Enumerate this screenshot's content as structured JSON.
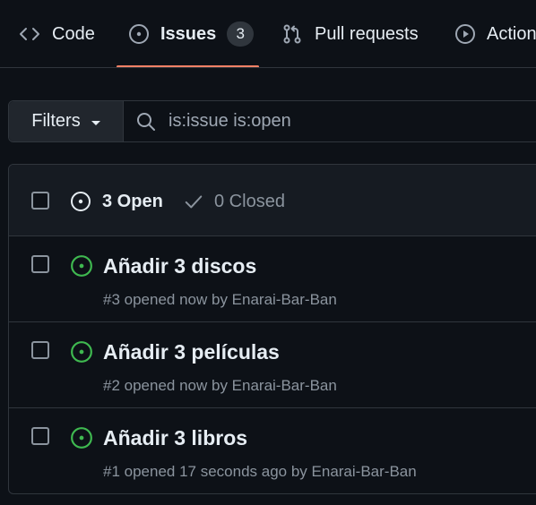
{
  "tabs": {
    "code": "Code",
    "issues": "Issues",
    "issues_count": "3",
    "pull_requests": "Pull requests",
    "actions": "Actions"
  },
  "filters": {
    "button_label": "Filters",
    "search_value": "is:issue is:open"
  },
  "states": {
    "open_label": "3 Open",
    "closed_label": "0 Closed"
  },
  "issues": [
    {
      "title": "Añadir 3 discos",
      "meta": "#3 opened now by Enarai-Bar-Ban"
    },
    {
      "title": "Añadir 3 películas",
      "meta": "#2 opened now by Enarai-Bar-Ban"
    },
    {
      "title": "Añadir 3 libros",
      "meta": "#1 opened 17 seconds ago by Enarai-Bar-Ban"
    }
  ],
  "colors": {
    "background": "#0d1117",
    "header_background": "#161b22",
    "border": "#30363d",
    "open_green": "#3fb950",
    "active_underline": "#f78166",
    "muted_text": "#8b949e"
  },
  "icons": {
    "code": "code-icon",
    "issues": "issue-opened-icon",
    "pull_requests": "git-pull-request-icon",
    "actions": "play-icon",
    "search": "search-icon",
    "closed": "check-icon"
  }
}
